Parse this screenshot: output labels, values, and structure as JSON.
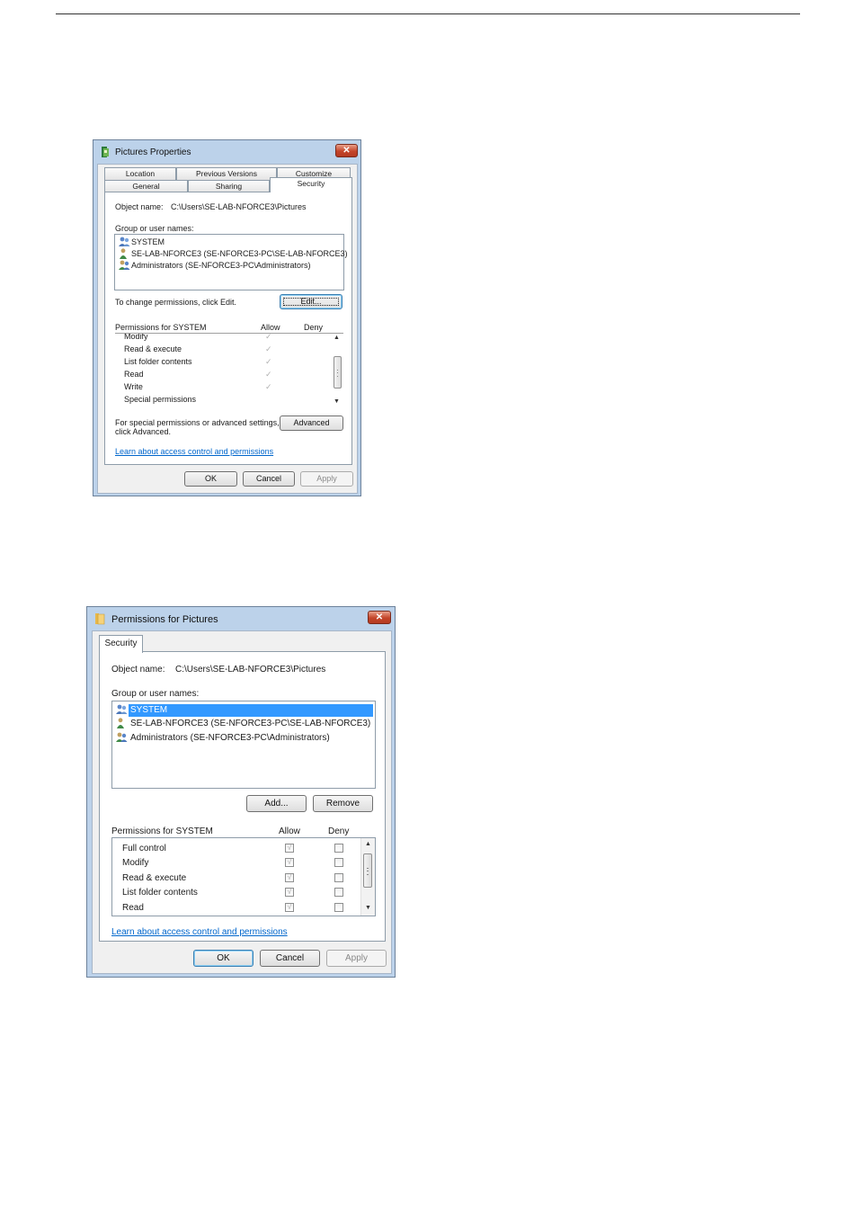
{
  "dialog1": {
    "title": "Pictures Properties",
    "close_glyph": "✕",
    "tabs_row1": [
      "Location",
      "Previous Versions",
      "Customize"
    ],
    "tabs_row2": [
      "General",
      "Sharing",
      "Security"
    ],
    "object_label": "Object name:",
    "object_value": "C:\\Users\\SE-LAB-NFORCE3\\Pictures",
    "group_label": "Group or user names:",
    "users": [
      "SYSTEM",
      "SE-LAB-NFORCE3 (SE-NFORCE3-PC\\SE-LAB-NFORCE3)",
      "Administrators (SE-NFORCE3-PC\\Administrators)"
    ],
    "change_text": "To change permissions, click Edit.",
    "edit_button": "Edit...",
    "perm_label": "Permissions for SYSTEM",
    "allow_header": "Allow",
    "deny_header": "Deny",
    "permissions": [
      "Modify",
      "Read & execute",
      "List folder contents",
      "Read",
      "Write",
      "Special permissions"
    ],
    "check_glyph": "✓",
    "special_text_1": "For special permissions or advanced settings,",
    "special_text_2": "click Advanced.",
    "advanced_button": "Advanced",
    "learn_link": "Learn about access control and permissions",
    "ok_button": "OK",
    "cancel_button": "Cancel",
    "apply_button": "Apply"
  },
  "dialog2": {
    "title": "Permissions for Pictures",
    "close_glyph": "✕",
    "tab": "Security",
    "object_label": "Object name:",
    "object_value": "C:\\Users\\SE-LAB-NFORCE3\\Pictures",
    "group_label": "Group or user names:",
    "users": [
      "SYSTEM",
      "SE-LAB-NFORCE3 (SE-NFORCE3-PC\\SE-LAB-NFORCE3)",
      "Administrators (SE-NFORCE3-PC\\Administrators)"
    ],
    "selected_user": "SYSTEM",
    "add_button": "Add...",
    "remove_button": "Remove",
    "perm_label": "Permissions for SYSTEM",
    "allow_header": "Allow",
    "deny_header": "Deny",
    "permissions": [
      {
        "name": "Full control",
        "allow": true,
        "deny": false
      },
      {
        "name": "Modify",
        "allow": true,
        "deny": false
      },
      {
        "name": "Read & execute",
        "allow": true,
        "deny": false
      },
      {
        "name": "List folder contents",
        "allow": true,
        "deny": false
      },
      {
        "name": "Read",
        "allow": true,
        "deny": false
      }
    ],
    "check_glyph": "√",
    "learn_link": "Learn about access control and permissions",
    "ok_button": "OK",
    "cancel_button": "Cancel",
    "apply_button": "Apply"
  },
  "colors": {
    "window_frame": "#bcd2ea",
    "client_bg": "#f0f0f0",
    "selection": "#3399ff",
    "link": "#0066cc",
    "close_button": "#c4452a"
  },
  "icons": {
    "dialog1_app": "pictures-library-icon",
    "dialog2_app": "folder-icon",
    "system_user": "user-group-icon",
    "single_user": "user-icon",
    "admins": "user-group-icon"
  }
}
